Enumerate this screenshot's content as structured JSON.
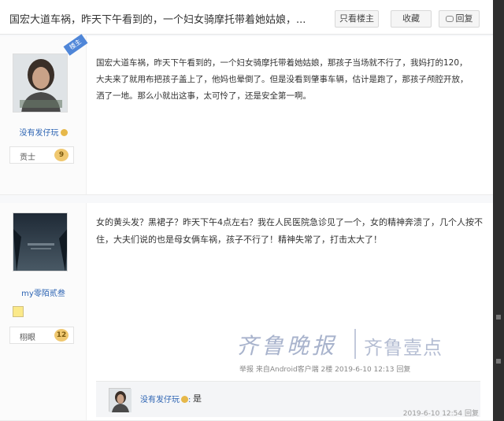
{
  "header": {
    "title": "国宏大道车祸，昨天下午看到的，一个妇女骑摩托带着她姑娘，...",
    "only_op_label": "只看楼主",
    "collect_label": "收藏",
    "reply_label": "回复"
  },
  "posts": [
    {
      "is_op_badge": "楼主",
      "author": "没有发仔玩",
      "level_name": "贡士",
      "level": "9",
      "content": "国宏大道车祸，昨天下午看到的，一个妇女骑摩托带着她姑娘，那孩子当场就不行了，我妈打的120，大夫来了就用布把孩子盖上了，他妈也晕倒了。但是没看到肇事车辆，估计是跑了，那孩子颅腔开放，洒了一地。那么小就出这事，太可怜了，还是安全第一啊。"
    },
    {
      "author": "my零陌贰叁",
      "level_name": "栩眼",
      "level": "12",
      "content": "女的黄头发？黑裙子？昨天下午4点左右？我在人民医院急诊见了一个，女的精神奔溃了，几个人按不住，大夫们说的也是母女俩车祸，孩子不行了！精神失常了，打击太大了！",
      "meta": "举报 来自Android客户端 2楼 2019-6-10 12:13 回复",
      "sub_reply": {
        "author": "没有发仔玩",
        "colon": ":",
        "text": "是",
        "meta": "2019-6-10 12:54 回复"
      }
    }
  ],
  "watermark": {
    "left": "齐鲁晚报",
    "right": "齐鲁壹点"
  },
  "colors": {
    "link": "#2d64b3",
    "op_badge": "#4f86d8",
    "level_badge": "#f0c870"
  }
}
